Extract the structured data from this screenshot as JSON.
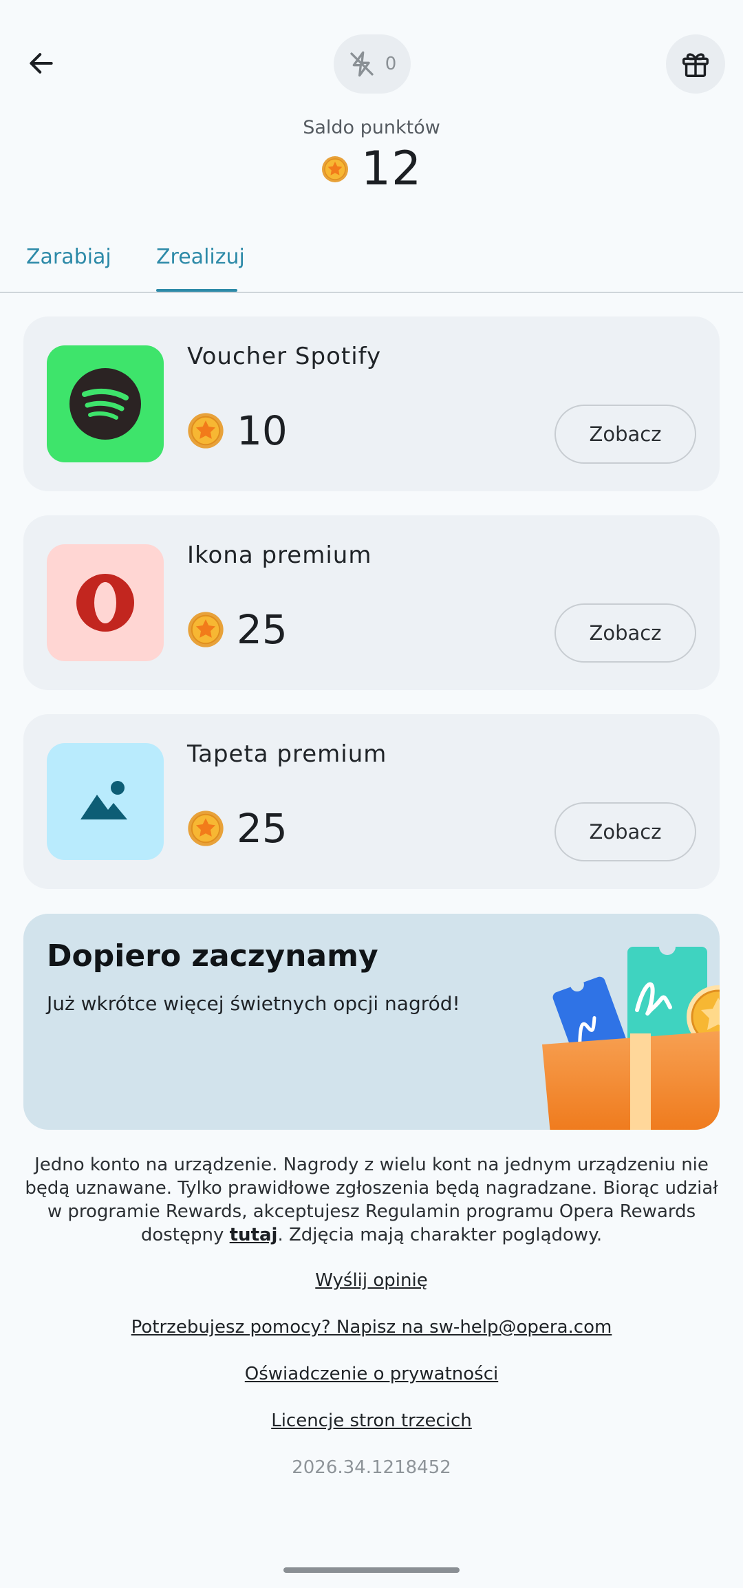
{
  "header": {
    "back_icon": "arrow-left-icon",
    "streak": {
      "icon": "flash-off-icon",
      "count": "0"
    },
    "gift_icon": "gift-icon"
  },
  "balance": {
    "label": "Saldo punktów",
    "value": "12",
    "coin_icon": "coin-star-icon"
  },
  "tabs": [
    {
      "label": "Zarabiaj",
      "selected": false
    },
    {
      "label": "Zrealizuj",
      "selected": true
    }
  ],
  "rewards": [
    {
      "title": "Voucher Spotify",
      "price": "10",
      "button": "Zobacz",
      "icon": "spotify-icon",
      "tile_color": "#3ee46b"
    },
    {
      "title": "Ikona premium",
      "price": "25",
      "button": "Zobacz",
      "icon": "opera-icon",
      "tile_color": "#ffd6d3"
    },
    {
      "title": "Tapeta premium",
      "price": "25",
      "button": "Zobacz",
      "icon": "landscape-image-icon",
      "tile_color": "#b9ebfd"
    }
  ],
  "promo": {
    "title": "Dopiero zaczynamy",
    "text": "Już wkrótce więcej świetnych opcji nagród!",
    "art_icon": "gift-box-vouchers-illustration"
  },
  "footer": {
    "disclaimer_before": "Jedno konto na urządzenie. Nagrody z wielu kont na jednym urządzeniu nie będą uznawane. Tylko prawidłowe zgłoszenia będą nagradzane. Biorąc udział w programie Rewards, akceptujesz Regulamin programu Opera Rewards dostępny ",
    "disclaimer_link": "tutaj",
    "disclaimer_after": ". Zdjęcia mają charakter poglądowy.",
    "links": [
      "Wyślij opinię",
      "Potrzebujesz pomocy? Napisz na sw-help@opera.com",
      "Oświadczenie o prywatności",
      "Licencje stron trzecich"
    ],
    "version": "2026.34.1218452"
  },
  "colors": {
    "accent": "#2d8aa8",
    "coin": "#f5a623",
    "background": "#f7fafc"
  }
}
